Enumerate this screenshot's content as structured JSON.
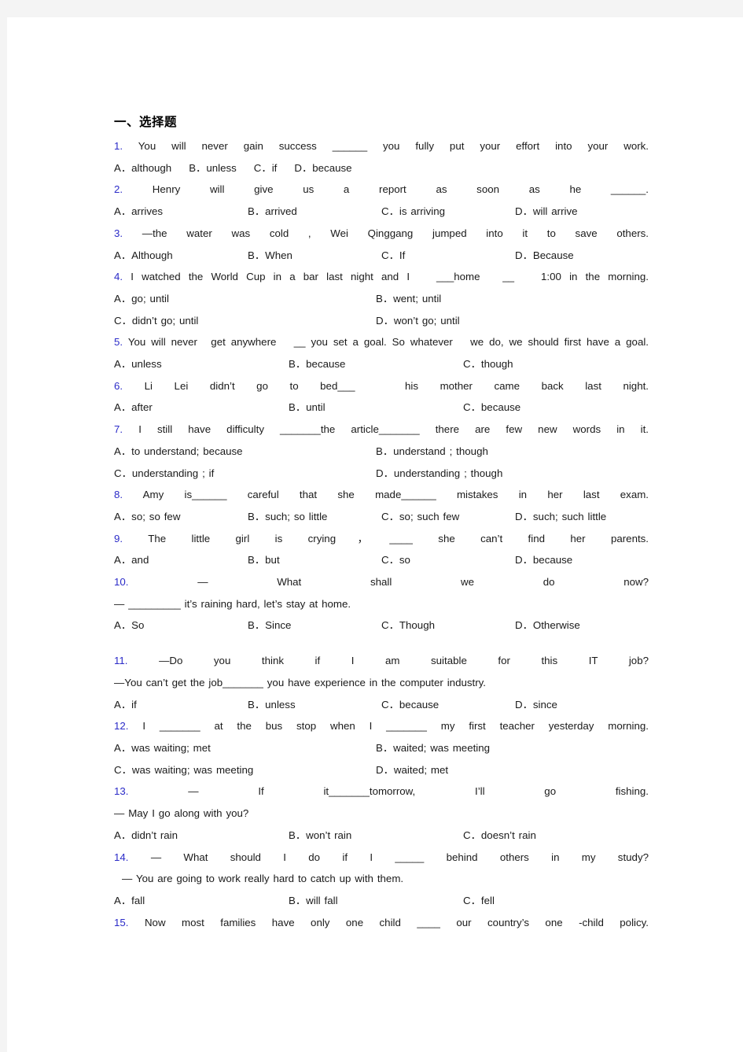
{
  "page": {
    "background_color": "#f4f4f4",
    "paper_color": "#ffffff",
    "qnum_color": "#2b2bc8",
    "text_color": "#1a1a1a"
  },
  "heading": "一、选择题",
  "questions": [
    {
      "num": "1.",
      "stem": "You will never gain success ______ you fully put your effort into your work.",
      "layout": "flow",
      "options": [
        "A．although",
        "B．unless",
        "C．if",
        "D．because"
      ]
    },
    {
      "num": "2.",
      "stem": "Henry will give us a report as soon as he ______.",
      "layout": "4col",
      "options": [
        "A．arrives",
        "B．arrived",
        "C．is arriving",
        "D．will arrive"
      ]
    },
    {
      "num": "3.",
      "stem": "—the water was cold , Wei Qinggang jumped into it to save others.",
      "layout": "4col",
      "options": [
        "A．Although",
        "B．When",
        "C．If",
        "D．Because"
      ]
    },
    {
      "num": "4.",
      "stem": "I watched the World Cup in a bar last night and I　 ___home 　__　 1:00 in the morning.",
      "layout": "2col",
      "options": [
        "A．go; until",
        "B．went; until",
        "C．didn’t go; until",
        "D．won’t go; until"
      ]
    },
    {
      "num": "5.",
      "stem": "You will never　get anywhere 　__ you set a goal. So whatever 　we do, we should first have a goal.",
      "layout": "3col",
      "options": [
        "A．unless",
        "B．because",
        "C．though"
      ]
    },
    {
      "num": "6.",
      "stem": "Li Lei didn’t go to bed___ 　his mother came back last night.",
      "layout": "3col",
      "options": [
        "A．after",
        "B．until",
        "C．because"
      ]
    },
    {
      "num": "7.",
      "stem": "I still have difficulty _______the article_______ there are few new words in it.",
      "layout": "2col",
      "options": [
        "A．to understand; because",
        "B．understand ; though",
        "C．understanding ; if",
        "D．understanding ; though"
      ]
    },
    {
      "num": "8.",
      "stem": "Amy is______ careful that she made______ mistakes in her last exam.",
      "layout": "4col",
      "options": [
        "A．so; so few",
        "B．such; so little",
        "C．so; such few",
        "D．such; such little"
      ]
    },
    {
      "num": "9.",
      "stem": "The little girl is crying，____ she can’t find her parents.",
      "layout": "4col",
      "options": [
        "A．and",
        "B．but",
        "C．so",
        "D．because"
      ]
    },
    {
      "num": "10.",
      "stem": "— What shall we do now?",
      "stem2": "— _________ it’s raining hard, let’s stay at home.",
      "layout": "4col",
      "options": [
        "A．So",
        "B．Since",
        "C．Though",
        "D．Otherwise"
      ],
      "gap_after": true
    },
    {
      "num": "11.",
      "stem": "—Do you think if I am suitable for this IT job?",
      "stem2": "—You can’t get the job_______ you have experience in the computer industry.",
      "layout": "4col",
      "options": [
        "A．if",
        "B．unless",
        "C．because",
        "D．since"
      ]
    },
    {
      "num": "12.",
      "stem": "I _______ at the bus stop when I _______ my first teacher yesterday morning.",
      "layout": "2col",
      "options": [
        "A．was waiting; met",
        "B．waited; was meeting",
        "C．was waiting; was meeting",
        "D．waited; met"
      ]
    },
    {
      "num": "13.",
      "stem": "— If it_______tomorrow, I’ll go fishing.",
      "stem2": "— May I go along with you?",
      "layout": "3col",
      "options": [
        "A．didn’t rain",
        "B．won’t rain",
        "C．doesn’t rain"
      ]
    },
    {
      "num": "14.",
      "stem": "— What should I do if I _____ behind others in my study?",
      "stem2": "— You are going to work really hard to catch up with them.",
      "stem2_indent": true,
      "layout": "3col",
      "options": [
        "A．fall",
        "B．will fall",
        "C．fell"
      ]
    },
    {
      "num": "15.",
      "stem": "Now most families have only one child ____ our country’s one -child policy.",
      "layout": "none",
      "options": []
    }
  ]
}
